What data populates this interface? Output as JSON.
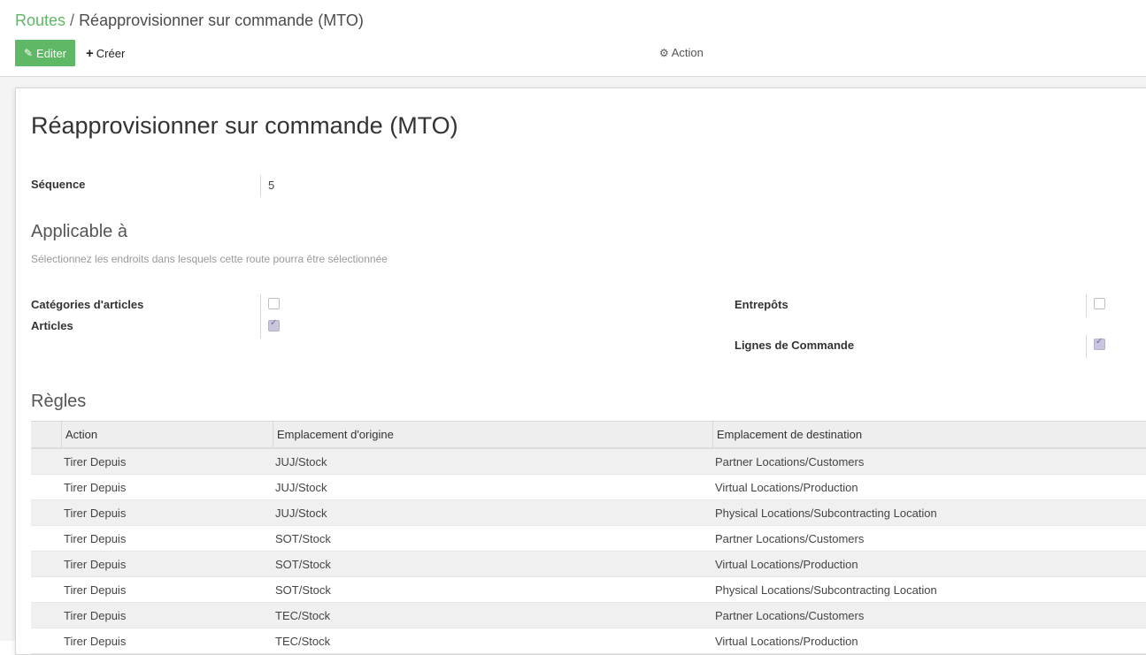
{
  "breadcrumb": {
    "parent": "Routes",
    "separator": "/",
    "current": "Réapprovisionner sur commande (MTO)"
  },
  "toolbar": {
    "edit_label": "Editer",
    "create_label": "Créer",
    "action_label": "Action"
  },
  "form": {
    "title": "Réapprovisionner sur commande (MTO)",
    "sequence_label": "Séquence",
    "sequence_value": "5",
    "applicable_title": "Applicable à",
    "applicable_help": "Sélectionnez les endroits dans lesquels cette route pourra être sélectionnée",
    "product_categories_label": "Catégories d'articles",
    "product_categories_checked": false,
    "products_label": "Articles",
    "products_checked": true,
    "warehouses_label": "Entrepôts",
    "warehouses_checked": false,
    "order_lines_label": "Lignes de Commande",
    "order_lines_checked": true,
    "rules_title": "Règles"
  },
  "rules_table": {
    "columns": [
      "Action",
      "Emplacement d'origine",
      "Emplacement de destination"
    ],
    "rows": [
      [
        "Tirer Depuis",
        "JUJ/Stock",
        "Partner Locations/Customers"
      ],
      [
        "Tirer Depuis",
        "JUJ/Stock",
        "Virtual Locations/Production"
      ],
      [
        "Tirer Depuis",
        "JUJ/Stock",
        "Physical Locations/Subcontracting Location"
      ],
      [
        "Tirer Depuis",
        "SOT/Stock",
        "Partner Locations/Customers"
      ],
      [
        "Tirer Depuis",
        "SOT/Stock",
        "Virtual Locations/Production"
      ],
      [
        "Tirer Depuis",
        "SOT/Stock",
        "Physical Locations/Subcontracting Location"
      ],
      [
        "Tirer Depuis",
        "TEC/Stock",
        "Partner Locations/Customers"
      ],
      [
        "Tirer Depuis",
        "TEC/Stock",
        "Virtual Locations/Production"
      ]
    ]
  },
  "icons": {
    "edit": "pencil-icon",
    "create": "plus-icon",
    "action": "gear-icon"
  },
  "colors": {
    "accent": "#5fb865",
    "checked": "#c9c6dd"
  }
}
